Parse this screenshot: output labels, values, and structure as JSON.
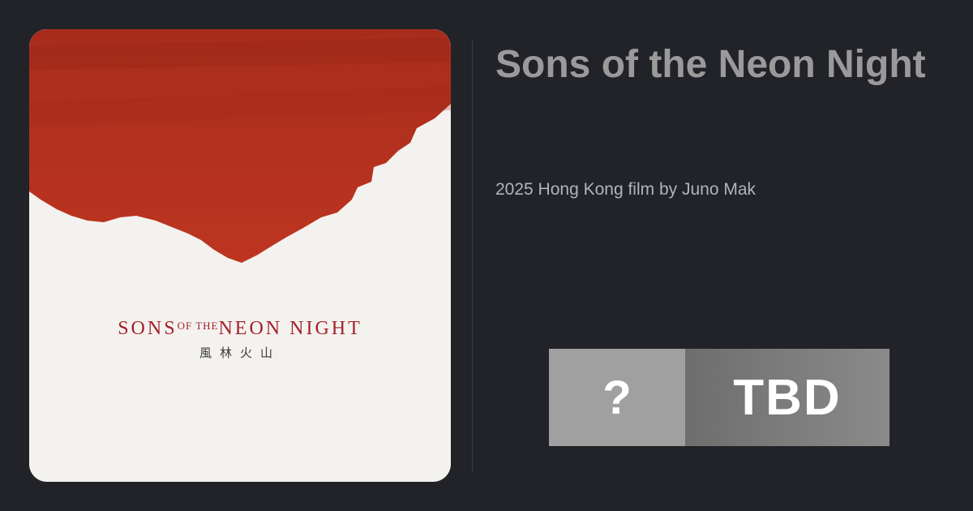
{
  "page": {
    "title": "Sons of the Neon Night",
    "subtitle": "2025 Hong Kong film by Juno Mak"
  },
  "poster": {
    "title_part1": "SONS",
    "title_part2": "OF THE",
    "title_part3": "NEON NIGHT",
    "chinese_title": "風林火山",
    "colors": {
      "red": "#b8321f",
      "paper": "#f4f2ee",
      "title_red": "#a3202a"
    }
  },
  "score": {
    "icon_text": "?",
    "label": "TBD"
  },
  "colors": {
    "background": "#212328",
    "title": "#9a9a9a",
    "subtitle": "#b0b4bb",
    "score_left": "#a0a0a0",
    "score_right": "#7a7a7a"
  }
}
